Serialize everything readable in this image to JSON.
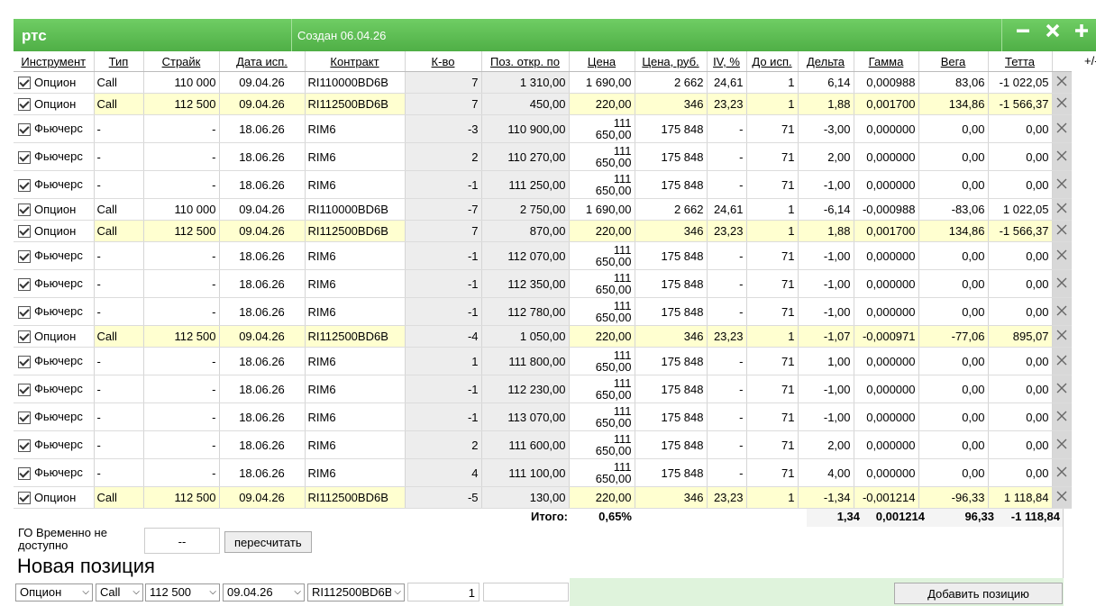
{
  "window": {
    "title": "ртс",
    "created": "Создан 06.04.26",
    "plusminus": "+/-"
  },
  "columns": [
    "Инструмент",
    "Тип",
    "Страйк",
    "Дата исп.",
    "Контракт",
    "К-во",
    "Поз. откр. по",
    "Цена",
    "Цена, руб.",
    "IV, %",
    "До исп.",
    "Дельта",
    "Гамма",
    "Вега",
    "Тетта"
  ],
  "rows": [
    {
      "inst": "Опцион",
      "type": "Call",
      "strike": "110 000",
      "date": "09.04.26",
      "contract": "RI110000BD6B",
      "qty": "7",
      "open": "1 310,00",
      "price": "1 690,00",
      "rub": "2 662",
      "iv": "24,61",
      "days": "1",
      "delta": "6,14",
      "gamma": "0,000988",
      "vega": "83,06",
      "theta": "-1 022,05",
      "hl": false
    },
    {
      "inst": "Опцион",
      "type": "Call",
      "strike": "112 500",
      "date": "09.04.26",
      "contract": "RI112500BD6B",
      "qty": "7",
      "open": "450,00",
      "price": "220,00",
      "rub": "346",
      "iv": "23,23",
      "days": "1",
      "delta": "1,88",
      "gamma": "0,001700",
      "vega": "134,86",
      "theta": "-1 566,37",
      "hl": true
    },
    {
      "inst": "Фьючерс",
      "type": "-",
      "strike": "-",
      "date": "18.06.26",
      "contract": "RIM6",
      "qty": "-3",
      "open": "110 900,00",
      "price1": "111",
      "price2": "650,00",
      "rub": "175 848",
      "iv": "-",
      "days": "71",
      "delta": "-3,00",
      "gamma": "0,000000",
      "vega": "0,00",
      "theta": "0,00"
    },
    {
      "inst": "Фьючерс",
      "type": "-",
      "strike": "-",
      "date": "18.06.26",
      "contract": "RIM6",
      "qty": "2",
      "open": "110 270,00",
      "price1": "111",
      "price2": "650,00",
      "rub": "175 848",
      "iv": "-",
      "days": "71",
      "delta": "2,00",
      "gamma": "0,000000",
      "vega": "0,00",
      "theta": "0,00"
    },
    {
      "inst": "Фьючерс",
      "type": "-",
      "strike": "-",
      "date": "18.06.26",
      "contract": "RIM6",
      "qty": "-1",
      "open": "111 250,00",
      "price1": "111",
      "price2": "650,00",
      "rub": "175 848",
      "iv": "-",
      "days": "71",
      "delta": "-1,00",
      "gamma": "0,000000",
      "vega": "0,00",
      "theta": "0,00"
    },
    {
      "inst": "Опцион",
      "type": "Call",
      "strike": "110 000",
      "date": "09.04.26",
      "contract": "RI110000BD6B",
      "qty": "-7",
      "open": "2 750,00",
      "price": "1 690,00",
      "rub": "2 662",
      "iv": "24,61",
      "days": "1",
      "delta": "-6,14",
      "gamma": "-0,000988",
      "vega": "-83,06",
      "theta": "1 022,05",
      "hl": false
    },
    {
      "inst": "Опцион",
      "type": "Call",
      "strike": "112 500",
      "date": "09.04.26",
      "contract": "RI112500BD6B",
      "qty": "7",
      "open": "870,00",
      "price": "220,00",
      "rub": "346",
      "iv": "23,23",
      "days": "1",
      "delta": "1,88",
      "gamma": "0,001700",
      "vega": "134,86",
      "theta": "-1 566,37",
      "hl": true
    },
    {
      "inst": "Фьючерс",
      "type": "-",
      "strike": "-",
      "date": "18.06.26",
      "contract": "RIM6",
      "qty": "-1",
      "open": "112 070,00",
      "price1": "111",
      "price2": "650,00",
      "rub": "175 848",
      "iv": "-",
      "days": "71",
      "delta": "-1,00",
      "gamma": "0,000000",
      "vega": "0,00",
      "theta": "0,00"
    },
    {
      "inst": "Фьючерс",
      "type": "-",
      "strike": "-",
      "date": "18.06.26",
      "contract": "RIM6",
      "qty": "-1",
      "open": "112 350,00",
      "price1": "111",
      "price2": "650,00",
      "rub": "175 848",
      "iv": "-",
      "days": "71",
      "delta": "-1,00",
      "gamma": "0,000000",
      "vega": "0,00",
      "theta": "0,00"
    },
    {
      "inst": "Фьючерс",
      "type": "-",
      "strike": "-",
      "date": "18.06.26",
      "contract": "RIM6",
      "qty": "-1",
      "open": "112 780,00",
      "price1": "111",
      "price2": "650,00",
      "rub": "175 848",
      "iv": "-",
      "days": "71",
      "delta": "-1,00",
      "gamma": "0,000000",
      "vega": "0,00",
      "theta": "0,00"
    },
    {
      "inst": "Опцион",
      "type": "Call",
      "strike": "112 500",
      "date": "09.04.26",
      "contract": "RI112500BD6B",
      "qty": "-4",
      "open": "1 050,00",
      "price": "220,00",
      "rub": "346",
      "iv": "23,23",
      "days": "1",
      "delta": "-1,07",
      "gamma": "-0,000971",
      "vega": "-77,06",
      "theta": "895,07",
      "hl": true
    },
    {
      "inst": "Фьючерс",
      "type": "-",
      "strike": "-",
      "date": "18.06.26",
      "contract": "RIM6",
      "qty": "1",
      "open": "111 800,00",
      "price1": "111",
      "price2": "650,00",
      "rub": "175 848",
      "iv": "-",
      "days": "71",
      "delta": "1,00",
      "gamma": "0,000000",
      "vega": "0,00",
      "theta": "0,00"
    },
    {
      "inst": "Фьючерс",
      "type": "-",
      "strike": "-",
      "date": "18.06.26",
      "contract": "RIM6",
      "qty": "-1",
      "open": "112 230,00",
      "price1": "111",
      "price2": "650,00",
      "rub": "175 848",
      "iv": "-",
      "days": "71",
      "delta": "-1,00",
      "gamma": "0,000000",
      "vega": "0,00",
      "theta": "0,00"
    },
    {
      "inst": "Фьючерс",
      "type": "-",
      "strike": "-",
      "date": "18.06.26",
      "contract": "RIM6",
      "qty": "-1",
      "open": "113 070,00",
      "price1": "111",
      "price2": "650,00",
      "rub": "175 848",
      "iv": "-",
      "days": "71",
      "delta": "-1,00",
      "gamma": "0,000000",
      "vega": "0,00",
      "theta": "0,00"
    },
    {
      "inst": "Фьючерс",
      "type": "-",
      "strike": "-",
      "date": "18.06.26",
      "contract": "RIM6",
      "qty": "2",
      "open": "111 600,00",
      "price1": "111",
      "price2": "650,00",
      "rub": "175 848",
      "iv": "-",
      "days": "71",
      "delta": "2,00",
      "gamma": "0,000000",
      "vega": "0,00",
      "theta": "0,00"
    },
    {
      "inst": "Фьючерс",
      "type": "-",
      "strike": "-",
      "date": "18.06.26",
      "contract": "RIM6",
      "qty": "4",
      "open": "111 100,00",
      "price1": "111",
      "price2": "650,00",
      "rub": "175 848",
      "iv": "-",
      "days": "71",
      "delta": "4,00",
      "gamma": "0,000000",
      "vega": "0,00",
      "theta": "0,00"
    },
    {
      "inst": "Опцион",
      "type": "Call",
      "strike": "112 500",
      "date": "09.04.26",
      "contract": "RI112500BD6B",
      "qty": "-5",
      "open": "130,00",
      "price": "220,00",
      "rub": "346",
      "iv": "23,23",
      "days": "1",
      "delta": "-1,34",
      "gamma": "-0,001214",
      "vega": "-96,33",
      "theta": "1 118,84",
      "hl": true
    }
  ],
  "totals": {
    "label": "Итого:",
    "pct": "0,65%",
    "delta": "1,34",
    "gamma": "0,001214",
    "vega": "96,33",
    "theta": "-1 118,84"
  },
  "go": {
    "label": "ГО Временно не доступно",
    "value": "--",
    "recalc": "пересчитать"
  },
  "newpos": {
    "title": "Новая позиция",
    "inst": "Опцион",
    "type": "Call",
    "strike": "112 500",
    "date": "09.04.26",
    "contract": "RI112500BD6B",
    "qty": "1",
    "add": "Добавить позицию"
  },
  "colors": {
    "header_green": "#5bbd50",
    "highlight": "#ffffd0"
  }
}
